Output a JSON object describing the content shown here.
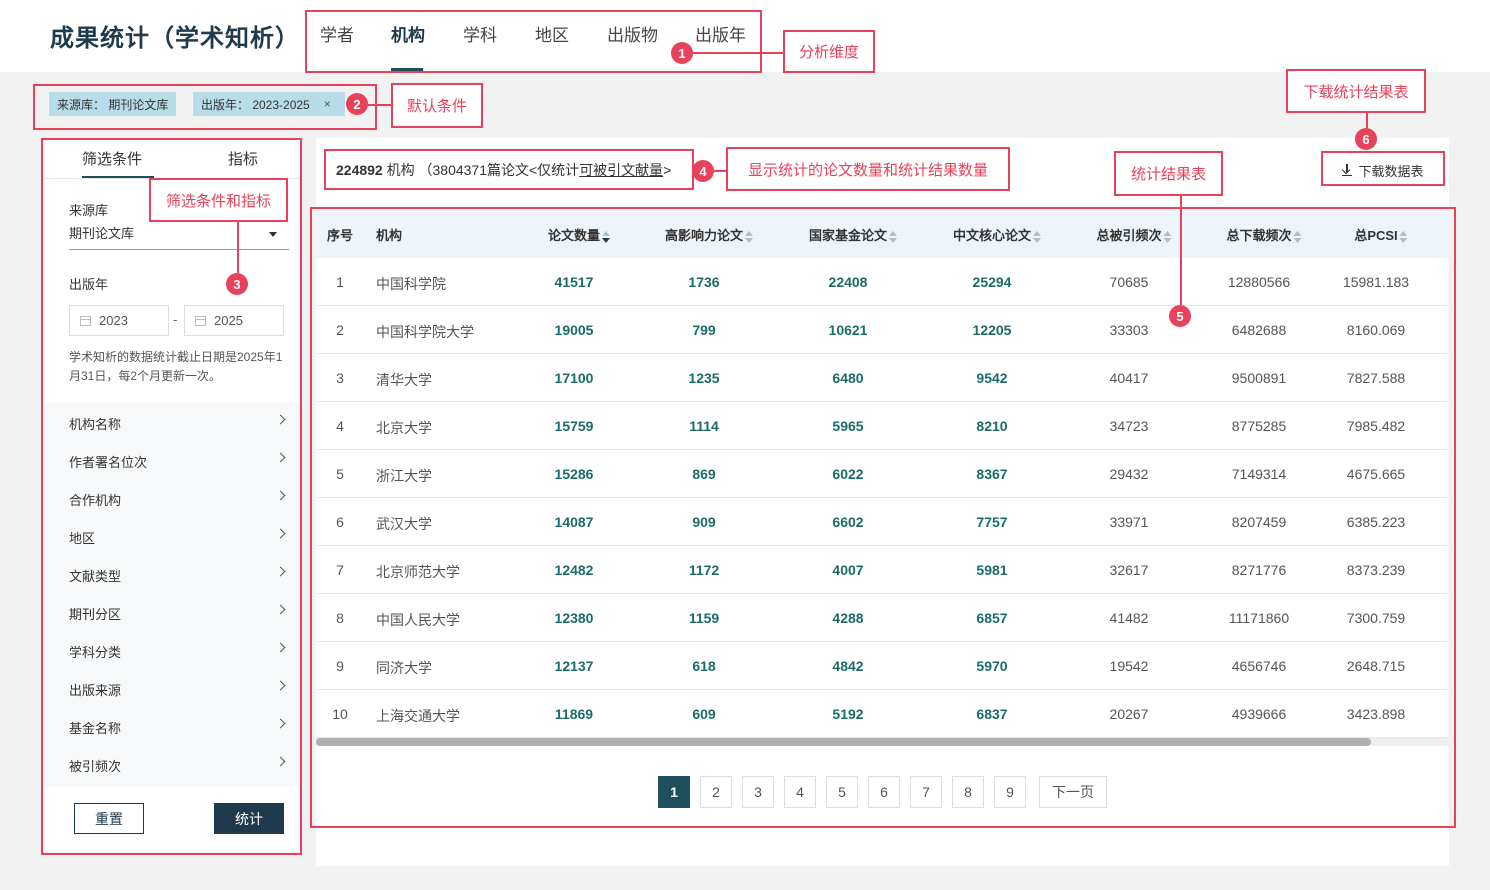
{
  "header": {
    "title": "成果统计（学术知析）",
    "tabs": [
      {
        "label": "学者"
      },
      {
        "label": "机构"
      },
      {
        "label": "学科"
      },
      {
        "label": "地区"
      },
      {
        "label": "出版物"
      },
      {
        "label": "出版年"
      }
    ],
    "active_tab": "机构"
  },
  "conditions": {
    "chips": [
      {
        "label": "来源库：  期刊论文库"
      },
      {
        "label": "出版年：  2023-2025",
        "close": "×"
      }
    ]
  },
  "sidebar": {
    "tabs": [
      {
        "label": "筛选条件"
      },
      {
        "label": "指标"
      }
    ],
    "source_label": "来源库",
    "source_value": "期刊论文库",
    "year_label": "出版年",
    "year_from": "2023",
    "year_to": "2025",
    "year_sep": "-",
    "note": "学术知析的数据统计截止日期是2025年1月31日，每2个月更新一次。",
    "filters": [
      {
        "label": "机构名称"
      },
      {
        "label": "作者署名位次"
      },
      {
        "label": "合作机构"
      },
      {
        "label": "地区"
      },
      {
        "label": "文献类型"
      },
      {
        "label": "期刊分区"
      },
      {
        "label": "学科分类"
      },
      {
        "label": "出版来源"
      },
      {
        "label": "基金名称"
      },
      {
        "label": "被引频次"
      }
    ],
    "reset_label": "重置",
    "stat_label": "统计"
  },
  "summary": {
    "count": "224892",
    "unit": "机构",
    "detail": "（3804371篇论文<仅统计",
    "link": "可被引文献量",
    "tail": ">"
  },
  "download": {
    "label": "下载数据表"
  },
  "table": {
    "columns": [
      {
        "label": "序号"
      },
      {
        "label": "机构"
      },
      {
        "label": "论文数量"
      },
      {
        "label": "高影响力论文"
      },
      {
        "label": "国家基金论文"
      },
      {
        "label": "中文核心论文"
      },
      {
        "label": "总被引频次"
      },
      {
        "label": "总下载频次"
      },
      {
        "label": "总PCSI"
      }
    ],
    "rows": [
      {
        "no": "1",
        "org": "中国科学院",
        "papers": "41517",
        "high": "1736",
        "fund": "22408",
        "core": "25294",
        "cites": "70685",
        "downloads": "12880566",
        "pcsi": "15981.183"
      },
      {
        "no": "2",
        "org": "中国科学院大学",
        "papers": "19005",
        "high": "799",
        "fund": "10621",
        "core": "12205",
        "cites": "33303",
        "downloads": "6482688",
        "pcsi": "8160.069"
      },
      {
        "no": "3",
        "org": "清华大学",
        "papers": "17100",
        "high": "1235",
        "fund": "6480",
        "core": "9542",
        "cites": "40417",
        "downloads": "9500891",
        "pcsi": "7827.588"
      },
      {
        "no": "4",
        "org": "北京大学",
        "papers": "15759",
        "high": "1114",
        "fund": "5965",
        "core": "8210",
        "cites": "34723",
        "downloads": "8775285",
        "pcsi": "7985.482"
      },
      {
        "no": "5",
        "org": "浙江大学",
        "papers": "15286",
        "high": "869",
        "fund": "6022",
        "core": "8367",
        "cites": "29432",
        "downloads": "7149314",
        "pcsi": "4675.665"
      },
      {
        "no": "6",
        "org": "武汉大学",
        "papers": "14087",
        "high": "909",
        "fund": "6602",
        "core": "7757",
        "cites": "33971",
        "downloads": "8207459",
        "pcsi": "6385.223"
      },
      {
        "no": "7",
        "org": "北京师范大学",
        "papers": "12482",
        "high": "1172",
        "fund": "4007",
        "core": "5981",
        "cites": "32617",
        "downloads": "8271776",
        "pcsi": "8373.239"
      },
      {
        "no": "8",
        "org": "中国人民大学",
        "papers": "12380",
        "high": "1159",
        "fund": "4288",
        "core": "6857",
        "cites": "41482",
        "downloads": "11171860",
        "pcsi": "7300.759"
      },
      {
        "no": "9",
        "org": "同济大学",
        "papers": "12137",
        "high": "618",
        "fund": "4842",
        "core": "5970",
        "cites": "19542",
        "downloads": "4656746",
        "pcsi": "2648.715"
      },
      {
        "no": "10",
        "org": "上海交通大学",
        "papers": "11869",
        "high": "609",
        "fund": "5192",
        "core": "6837",
        "cites": "20267",
        "downloads": "4939666",
        "pcsi": "3423.898"
      }
    ]
  },
  "pagination": {
    "pages": [
      "1",
      "2",
      "3",
      "4",
      "5",
      "6",
      "7",
      "8",
      "9"
    ],
    "current": "1",
    "next_label": "下一页"
  },
  "annotations": [
    {
      "num": "1",
      "label": "分析维度"
    },
    {
      "num": "2",
      "label": "默认条件"
    },
    {
      "num": "3",
      "label": "筛选条件和指标"
    },
    {
      "num": "4",
      "label": "显示统计的论文数量和统计结果数量"
    },
    {
      "num": "5",
      "label": "统计结果表"
    },
    {
      "num": "6",
      "label": "下载统计结果表"
    }
  ],
  "colors": {
    "primary": "#1f3a4d",
    "accent_number": "#1b6b6b",
    "annotation": "#e8415a",
    "chip_bg": "#b9dde8",
    "header_bg": "#eef5fa"
  }
}
